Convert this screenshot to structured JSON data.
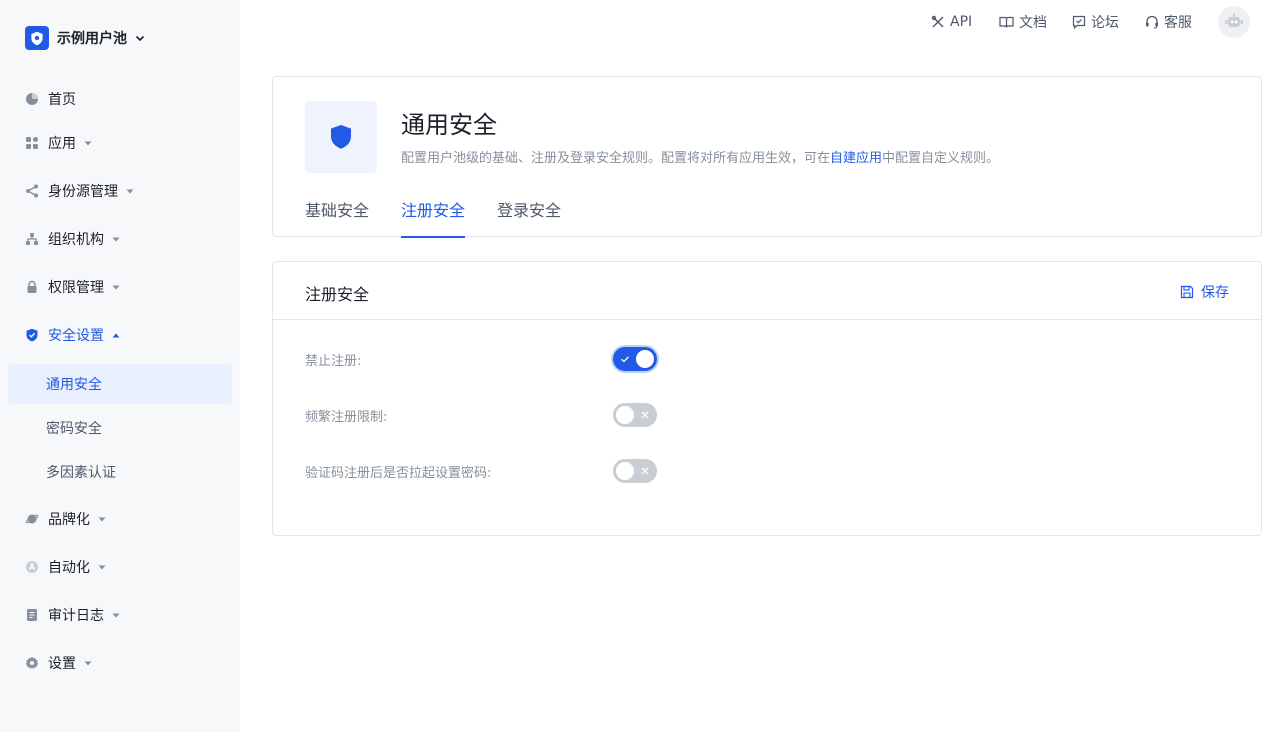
{
  "sidebar": {
    "pool_name": "示例用户池",
    "items": [
      {
        "label": "首页"
      },
      {
        "label": "应用"
      },
      {
        "label": "身份源管理"
      },
      {
        "label": "组织机构"
      },
      {
        "label": "权限管理"
      },
      {
        "label": "安全设置"
      },
      {
        "label": "品牌化"
      },
      {
        "label": "自动化"
      },
      {
        "label": "审计日志"
      },
      {
        "label": "设置"
      }
    ],
    "sub_items": [
      {
        "label": "通用安全",
        "active": true
      },
      {
        "label": "密码安全"
      },
      {
        "label": "多因素认证"
      }
    ]
  },
  "topbar": {
    "api": "API",
    "docs": "文档",
    "forum": "论坛",
    "support": "客服"
  },
  "header": {
    "title": "通用安全",
    "desc_before": "配置用户池级的基础、注册及登录安全规则。配置将对所有应用生效，可在",
    "desc_link": "自建应用",
    "desc_after": "中配置自定义规则。",
    "tabs": [
      "基础安全",
      "注册安全",
      "登录安全"
    ],
    "active_tab": "注册安全"
  },
  "settings": {
    "title": "注册安全",
    "save_label": "保存",
    "rows": [
      {
        "label": "禁止注册:",
        "enabled": true
      },
      {
        "label": "频繁注册限制:",
        "enabled": false
      },
      {
        "label": "验证码注册后是否拉起设置密码:",
        "enabled": false
      }
    ]
  },
  "colors": {
    "accent": "#215ae5",
    "sidebar_bg": "#f7f8fa",
    "active_bg": "#e8effe"
  }
}
